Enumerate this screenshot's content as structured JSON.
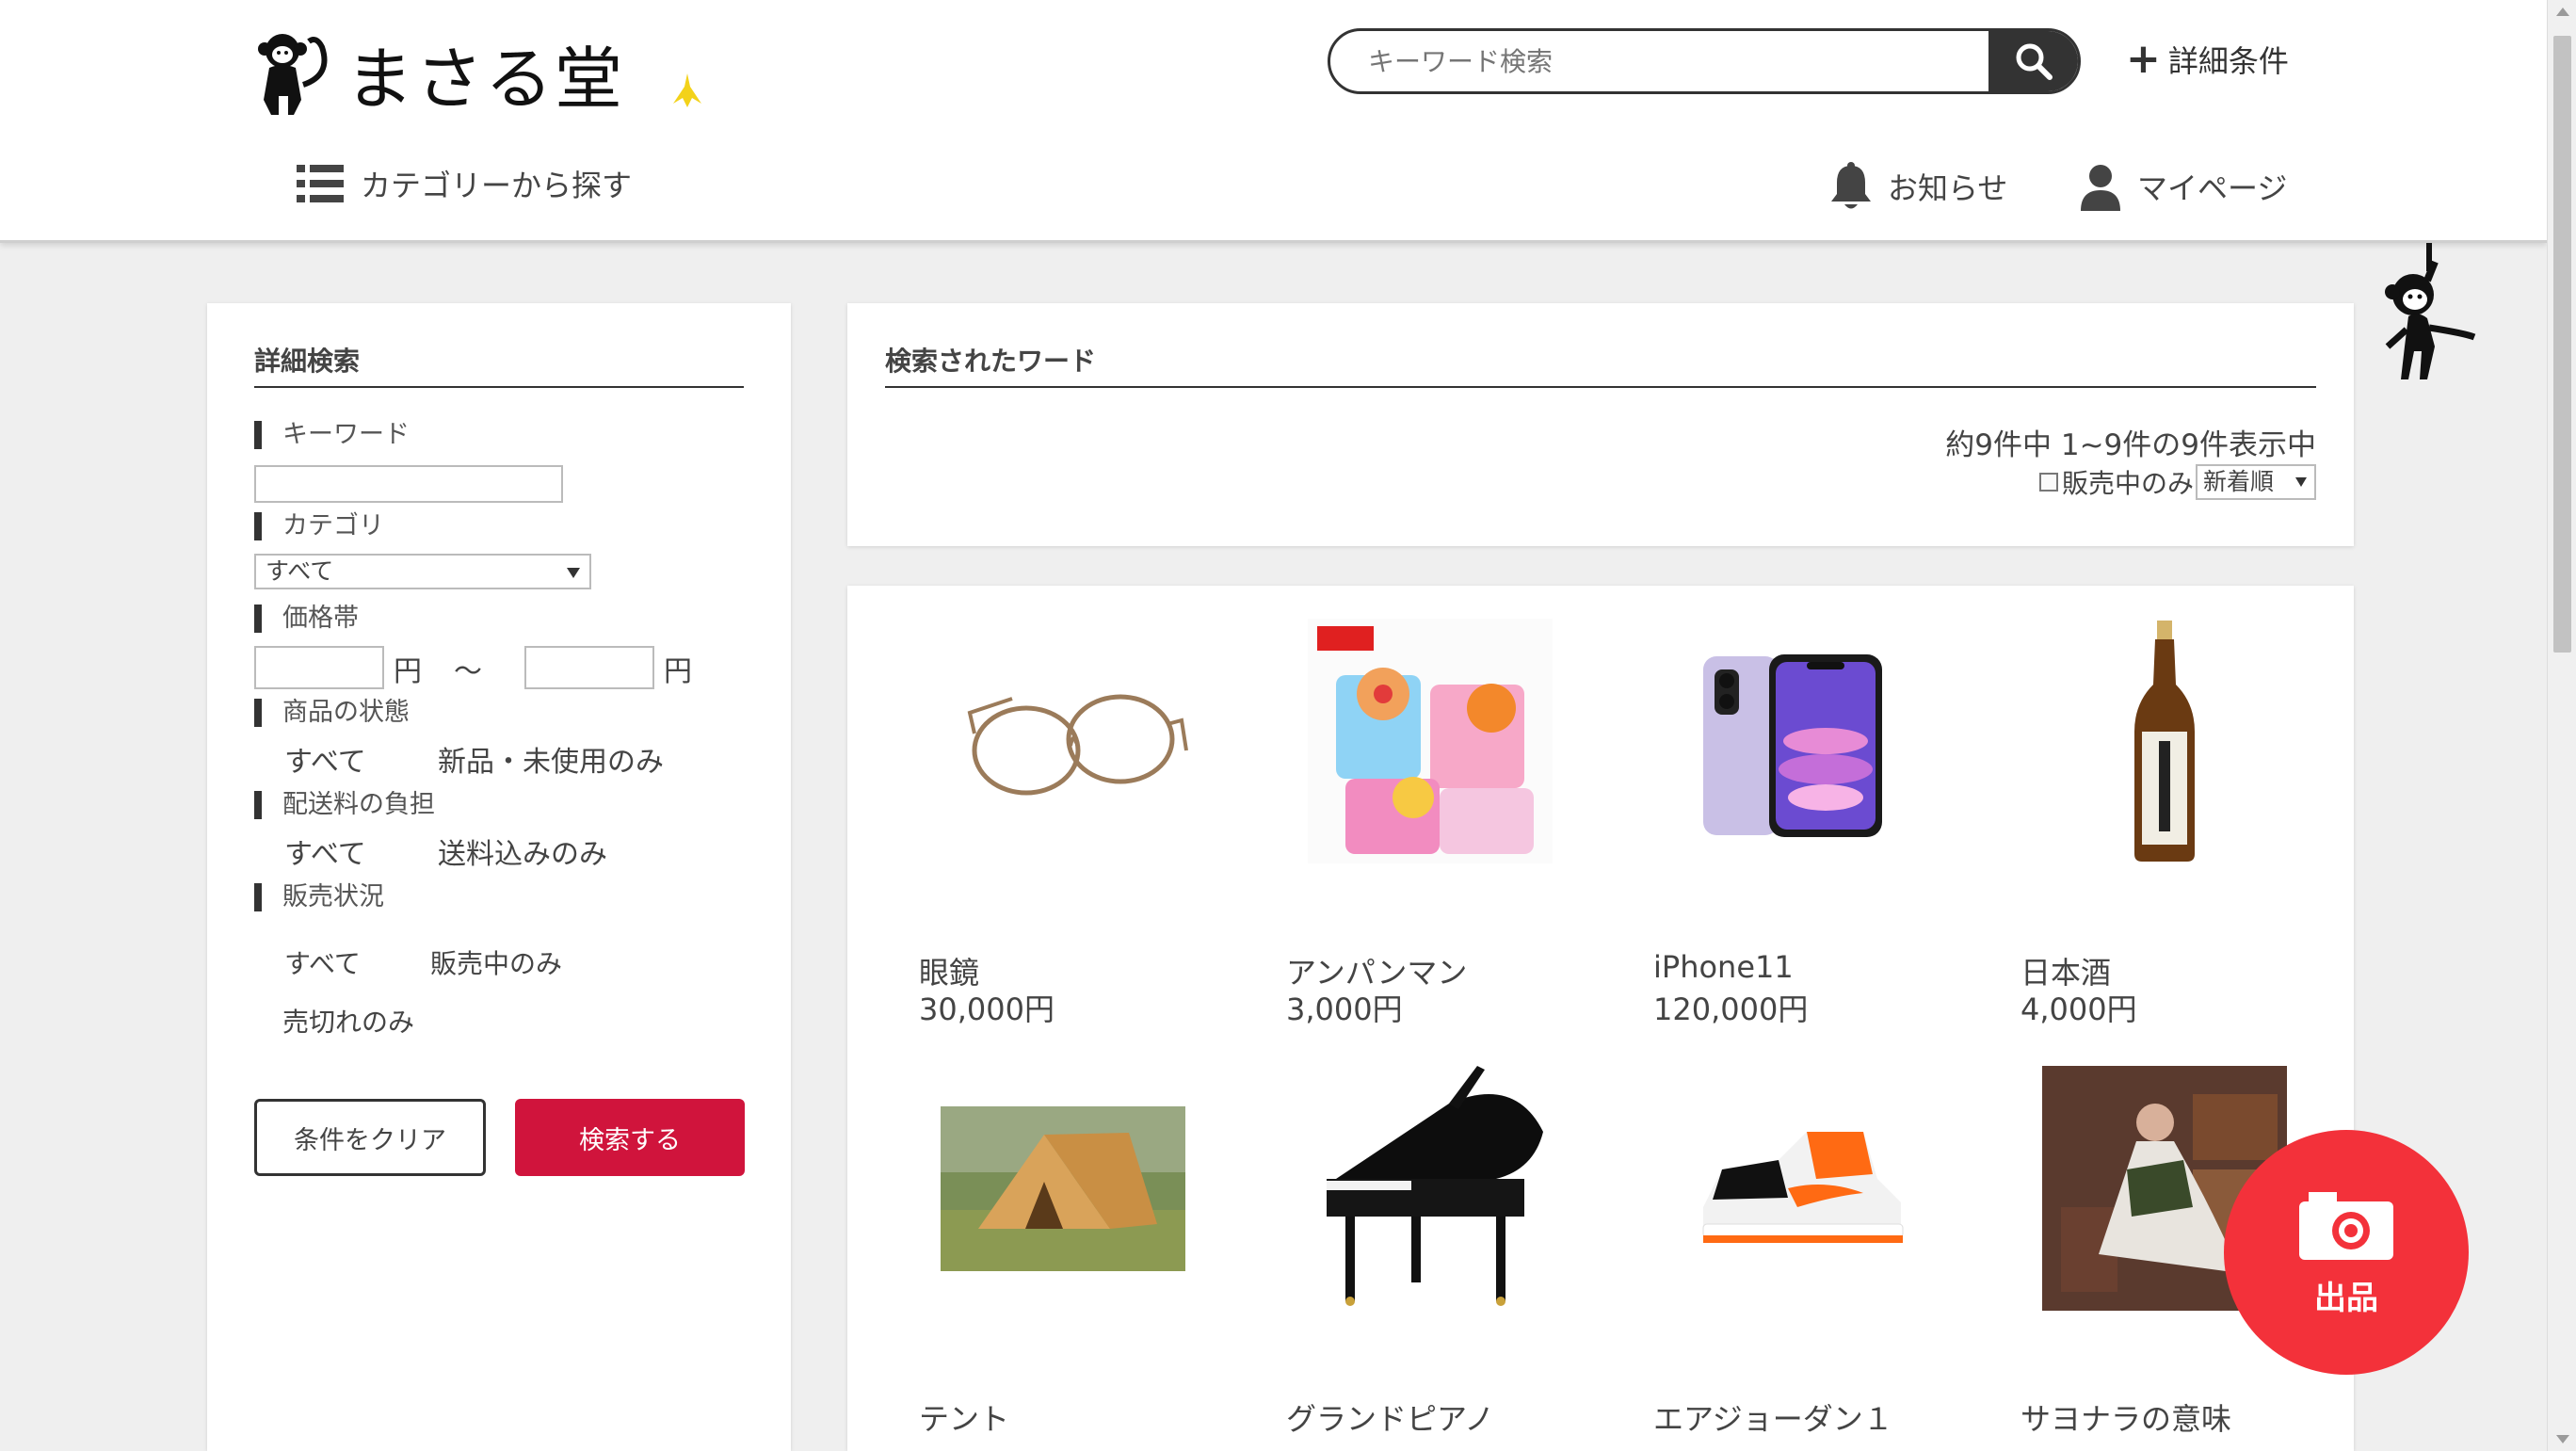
{
  "header": {
    "logo_text": "まさる堂",
    "search_placeholder": "キーワード検索",
    "detail_label": "詳細条件",
    "category_link": "カテゴリーから探す",
    "notice": "お知らせ",
    "mypage": "マイページ"
  },
  "side": {
    "title": "詳細検索",
    "keyword_label": "キーワード",
    "category_label": "カテゴリ",
    "category_value": "すべて",
    "price_label": "価格帯",
    "yen": "円",
    "tilde": "～",
    "condition_label": "商品の状態",
    "condition_all": "すべて",
    "condition_new": "新品・未使用のみ",
    "shipping_label": "配送料の負担",
    "shipping_all": "すべて",
    "shipping_included": "送料込みのみ",
    "status_label": "販売状況",
    "status_all": "すべて",
    "status_selling": "販売中のみ",
    "status_sold": "売切れのみ",
    "clear_button": "条件をクリア",
    "search_button": "検索する"
  },
  "results": {
    "title": "検索されたワード",
    "count_text": "約9件中 1~9件の9件表示中",
    "only_selling": "販売中のみ",
    "sort_value": "新着順"
  },
  "products": [
    {
      "name": "眼鏡",
      "price": "30,000円",
      "icon": "glasses-image"
    },
    {
      "name": "アンパンマン",
      "price": "3,000円",
      "icon": "anpanman-image"
    },
    {
      "name": "iPhone11",
      "price": "120,000円",
      "icon": "iphone-image"
    },
    {
      "name": "日本酒",
      "price": "4,000円",
      "icon": "sake-bottle-image"
    },
    {
      "name": "テント",
      "price": "",
      "icon": "tent-image"
    },
    {
      "name": "グランドピアノ",
      "price": "",
      "icon": "grand-piano-image"
    },
    {
      "name": "エアジョーダン１",
      "price": "",
      "icon": "sneaker-image"
    },
    {
      "name": "サヨナラの意味",
      "price": "",
      "icon": "photo-image"
    }
  ],
  "sell_button": "出品",
  "colors": {
    "accent_red": "#d0143c",
    "sell_red": "#f3313a",
    "dark": "#333333"
  }
}
